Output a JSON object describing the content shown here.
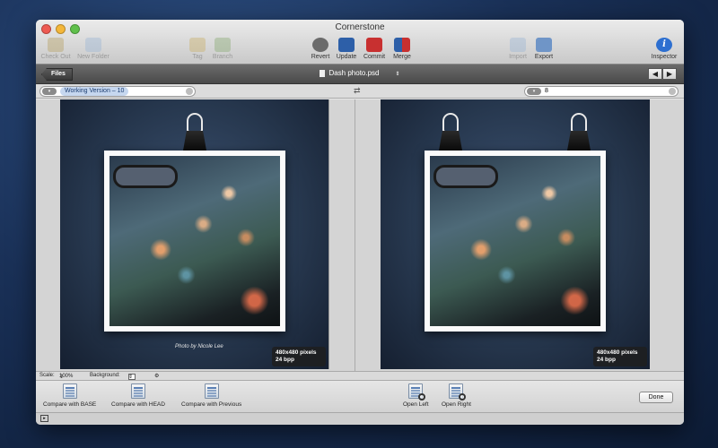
{
  "window": {
    "title": "Cornerstone"
  },
  "toolbar": {
    "checkout": "Check Out",
    "new_folder": "New Folder",
    "tag": "Tag",
    "branch": "Branch",
    "revert": "Revert",
    "update": "Update",
    "commit": "Commit",
    "merge": "Merge",
    "import": "Import",
    "export": "Export",
    "inspector": "Inspector"
  },
  "pathbar": {
    "files_label": "Files",
    "filename": "Dash photo.psd",
    "back_arrow": "◀",
    "forward_arrow": "▶"
  },
  "versions": {
    "left": "Working Version – 10",
    "right": "8"
  },
  "left_pane": {
    "caption": "Photo by Nicole Lee",
    "info_size": "480x480 pixels",
    "info_depth": "24 bpp"
  },
  "right_pane": {
    "info_size": "480x480 pixels",
    "info_depth": "24 bpp"
  },
  "scalebar": {
    "scale_label": "Scale:",
    "scale_value": "100%",
    "background_label": "Background:"
  },
  "bottombar": {
    "compare_base": "Compare with BASE",
    "compare_head": "Compare with HEAD",
    "compare_previous": "Compare with Previous",
    "open_left": "Open Left",
    "open_right": "Open Right",
    "done": "Done"
  },
  "colors": {
    "accent_blue": "#2d6fd0",
    "commit_red": "#c83030"
  }
}
